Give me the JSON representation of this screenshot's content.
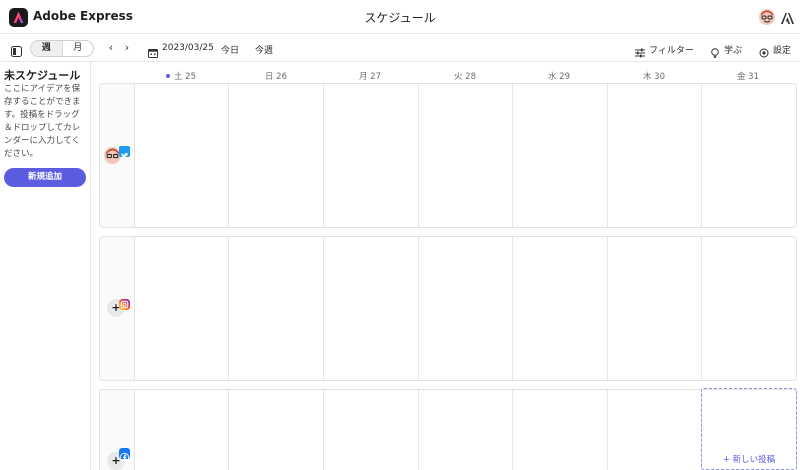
{
  "header": {
    "app_name": "Adobe Express",
    "page_title": "スケジュール"
  },
  "toolbar": {
    "view_week": "週",
    "view_month": "月",
    "prev_icon": "‹",
    "next_icon": "›",
    "date": "2023/03/25",
    "today": "今日",
    "this_week": "今週",
    "filter": "フィルター",
    "learn": "学ぶ",
    "settings": "設定"
  },
  "sidebar": {
    "title": "未スケジュール",
    "description": "ここにアイデアを保存することができます。投稿をドラッグ＆ドロップしてカレンダーに入力してください。",
    "add_button": "新規追加"
  },
  "days": [
    {
      "label": "土 25",
      "today": true
    },
    {
      "label": "日 26",
      "today": false
    },
    {
      "label": "月 27",
      "today": false
    },
    {
      "label": "火 28",
      "today": false
    },
    {
      "label": "水 29",
      "today": false
    },
    {
      "label": "木 30",
      "today": false
    },
    {
      "label": "金 31",
      "today": false
    }
  ],
  "rows": [
    {
      "channel": "twitter",
      "badge_color": "#1d9bf0",
      "avatar": "user-avatar"
    },
    {
      "channel": "instagram",
      "badge_color": "#d6249f",
      "avatar": "add-account"
    },
    {
      "channel": "facebook",
      "badge_color": "#1877f2",
      "avatar": "add-account"
    }
  ],
  "calendar": {
    "new_post": "+ 新しい投稿"
  },
  "colors": {
    "accent": "#5c5ce0",
    "border": "#e3e3e3"
  }
}
